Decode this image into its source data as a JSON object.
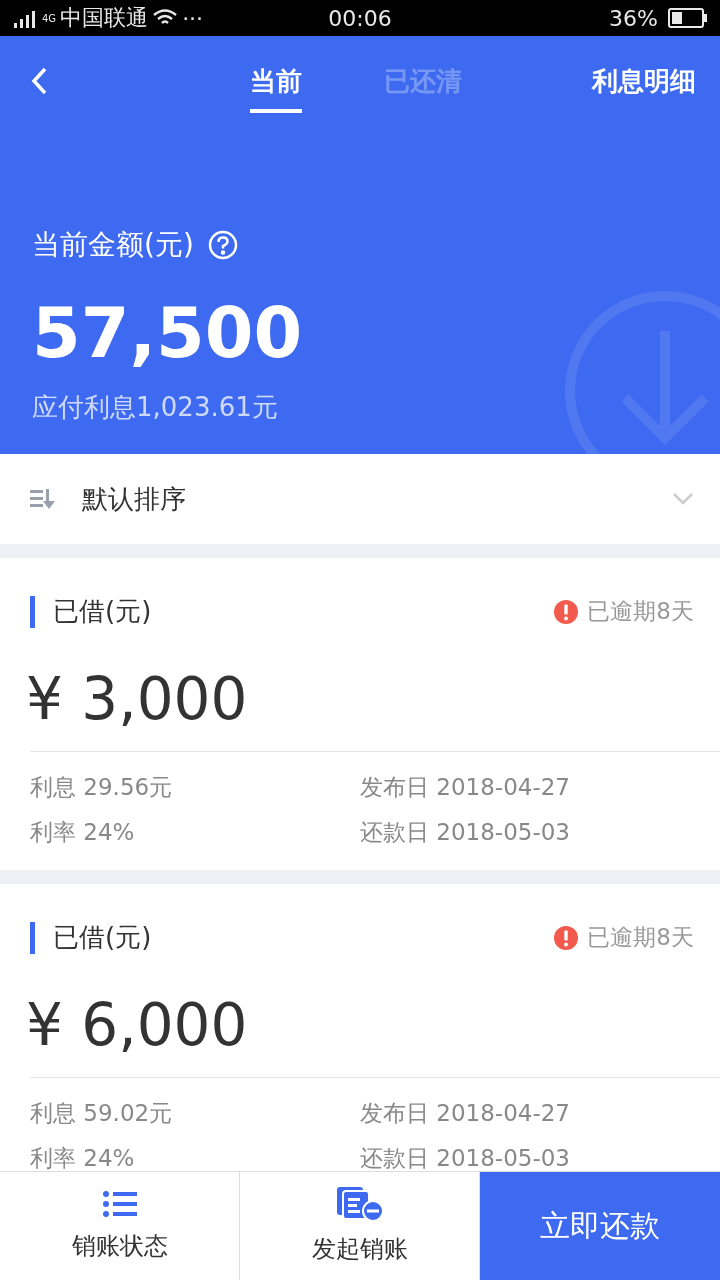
{
  "status_bar": {
    "network": "4G",
    "carrier": "中国联通",
    "dots": "···",
    "time": "00:06",
    "battery": "36%"
  },
  "nav": {
    "tabs": [
      {
        "label": "当前",
        "selected": true
      },
      {
        "label": "已还清",
        "selected": false
      }
    ],
    "action": "利息明细"
  },
  "summary": {
    "label": "当前金额(元)",
    "amount": "57,500",
    "interest": "应付利息1,023.61元"
  },
  "sort": {
    "label": "默认排序"
  },
  "loans": [
    {
      "title": "已借(元)",
      "overdue": true,
      "status": "已逾期8天",
      "amount": "¥ 3,000",
      "interest": "利息 29.56元",
      "publish_date": "发布日 2018-04-27",
      "rate": "利率 24%",
      "due_date": "还款日 2018-05-03"
    },
    {
      "title": "已借(元)",
      "overdue": true,
      "status": "已逾期8天",
      "amount": "¥ 6,000",
      "interest": "利息 59.02元",
      "publish_date": "发布日 2018-04-27",
      "rate": "利率 24%",
      "due_date": "还款日 2018-05-03"
    }
  ],
  "bottom_bar": {
    "items": [
      {
        "kind": "list",
        "label": "销账状态"
      },
      {
        "kind": "document",
        "label": "发起销账"
      }
    ],
    "primary": "立即还款"
  }
}
